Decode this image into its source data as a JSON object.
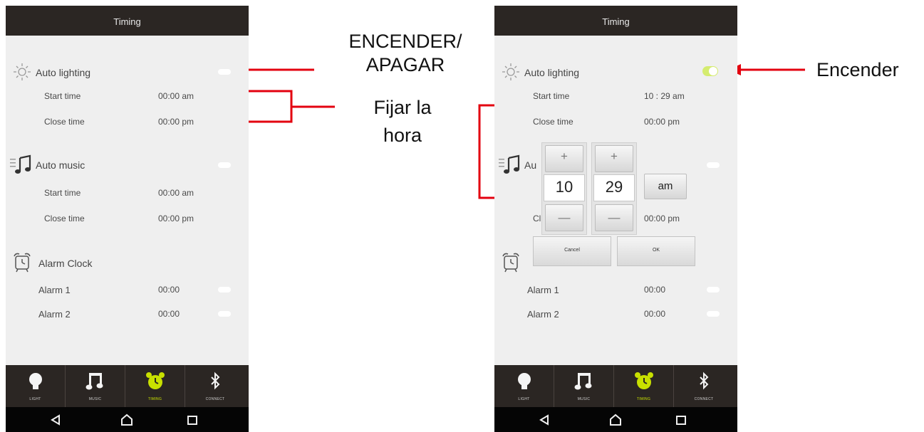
{
  "header_title": "Timing",
  "left": {
    "auto_lighting": {
      "label": "Auto lighting",
      "start_label": "Start time",
      "start_value": "00:00 am",
      "close_label": "Close time",
      "close_value": "00:00 pm"
    },
    "auto_music": {
      "label": "Auto music",
      "start_label": "Start time",
      "start_value": "00:00 am",
      "close_label": "Close time",
      "close_value": "00:00 pm"
    },
    "alarm": {
      "label": "Alarm Clock",
      "alarm1_label": "Alarm 1",
      "alarm1_value": "00:00",
      "alarm2_label": "Alarm 2",
      "alarm2_value": "00:00"
    }
  },
  "right": {
    "auto_lighting": {
      "label": "Auto lighting",
      "start_label": "Start time",
      "start_value": "10 : 29 am",
      "close_label": "Close time",
      "close_value": "00:00 pm",
      "toggle_on": true
    },
    "auto_music": {
      "label_partial": "Au",
      "close_label_partial": "Cl",
      "close_value": "00:00 pm"
    },
    "alarm": {
      "alarm1_label": "Alarm 1",
      "alarm1_value": "00:00",
      "alarm2_label": "Alarm 2",
      "alarm2_value": "00:00"
    },
    "picker": {
      "hour": "10",
      "minute": "29",
      "ampm": "am",
      "cancel": "Cancel",
      "ok": "OK",
      "plus": "+",
      "minus": "—"
    }
  },
  "tabs": [
    {
      "label": "LIGHT",
      "icon": "bulb-icon"
    },
    {
      "label": "MUSIC",
      "icon": "music-note-icon"
    },
    {
      "label": "TIMING",
      "icon": "alarm-clock-icon"
    },
    {
      "label": "CONNECT",
      "icon": "bluetooth-icon"
    }
  ],
  "nav": [
    "back-icon",
    "home-icon",
    "recents-icon"
  ],
  "annotations": {
    "on_off_line1": "ENCENDER/",
    "on_off_line2": "APAGAR",
    "set_time_line1": "Fijar la",
    "set_time_line2": "hora",
    "turn_on": "Encender"
  },
  "colors": {
    "accent": "#c8e000",
    "annotation_red": "#e3000f",
    "bar": "#2b2623"
  }
}
